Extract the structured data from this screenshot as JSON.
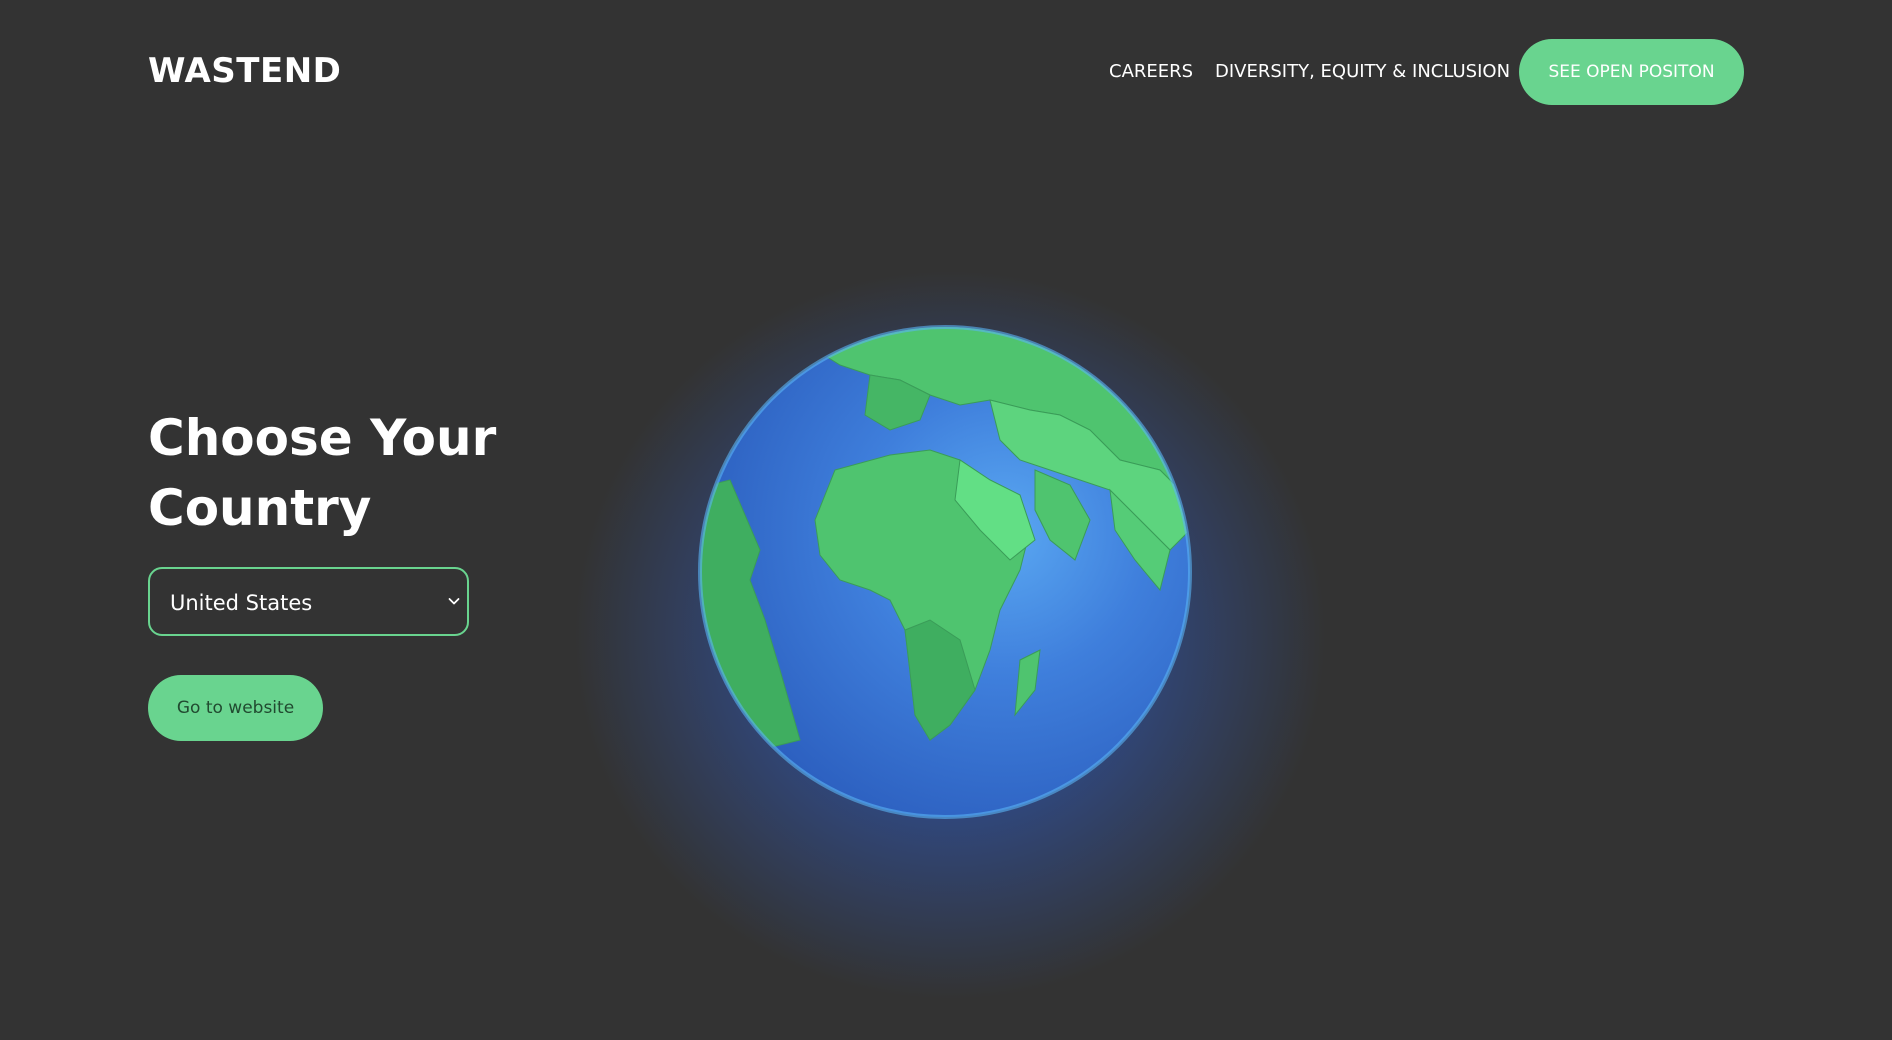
{
  "header": {
    "logo": "WASTEND",
    "nav": {
      "careers": "CAREERS",
      "dei": "DIVERSITY, EQUITY & INCLUSION"
    },
    "cta_label": "SEE OPEN POSITON"
  },
  "hero": {
    "title": "Choose Your Country",
    "country_select": {
      "selected": "United States",
      "icon": "chevron-down-icon"
    },
    "go_button_label": "Go to website",
    "globe_image": "low-poly-earth-globe"
  },
  "colors": {
    "background": "#333333",
    "accent": "#69d48f",
    "text": "#ffffff",
    "ocean": "#3f7fdc",
    "land": "#4fc46f"
  }
}
